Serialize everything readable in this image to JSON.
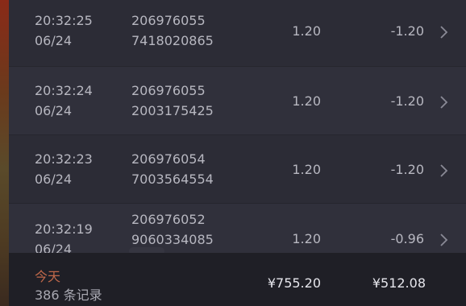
{
  "records": [
    {
      "time": "20:32:25",
      "date": "06/24",
      "order_line1": "206976055",
      "order_line2": "7418020865",
      "amount": "1.20",
      "net": "-1.20"
    },
    {
      "time": "20:32:24",
      "date": "06/24",
      "order_line1": "206976055",
      "order_line2": "2003175425",
      "amount": "1.20",
      "net": "-1.20"
    },
    {
      "time": "20:32:23",
      "date": "06/24",
      "order_line1": "206976054",
      "order_line2": "7003564554",
      "amount": "1.20",
      "net": "-1.20"
    },
    {
      "time": "20:32:19",
      "date": "06/24",
      "order_line1": "206976052",
      "order_line2": "9060334085",
      "amount": "1.20",
      "net": "-0.96"
    }
  ],
  "footer": {
    "period": "今天",
    "record_count": "386 条记录",
    "total_amount": "¥755.20",
    "total_net": "¥512.08"
  },
  "colors": {
    "background": "#2a2a33",
    "footer_background": "#1f1f26",
    "accent_period": "#c0684a"
  },
  "icons": {
    "row_chevron": "chevron-right-icon"
  }
}
